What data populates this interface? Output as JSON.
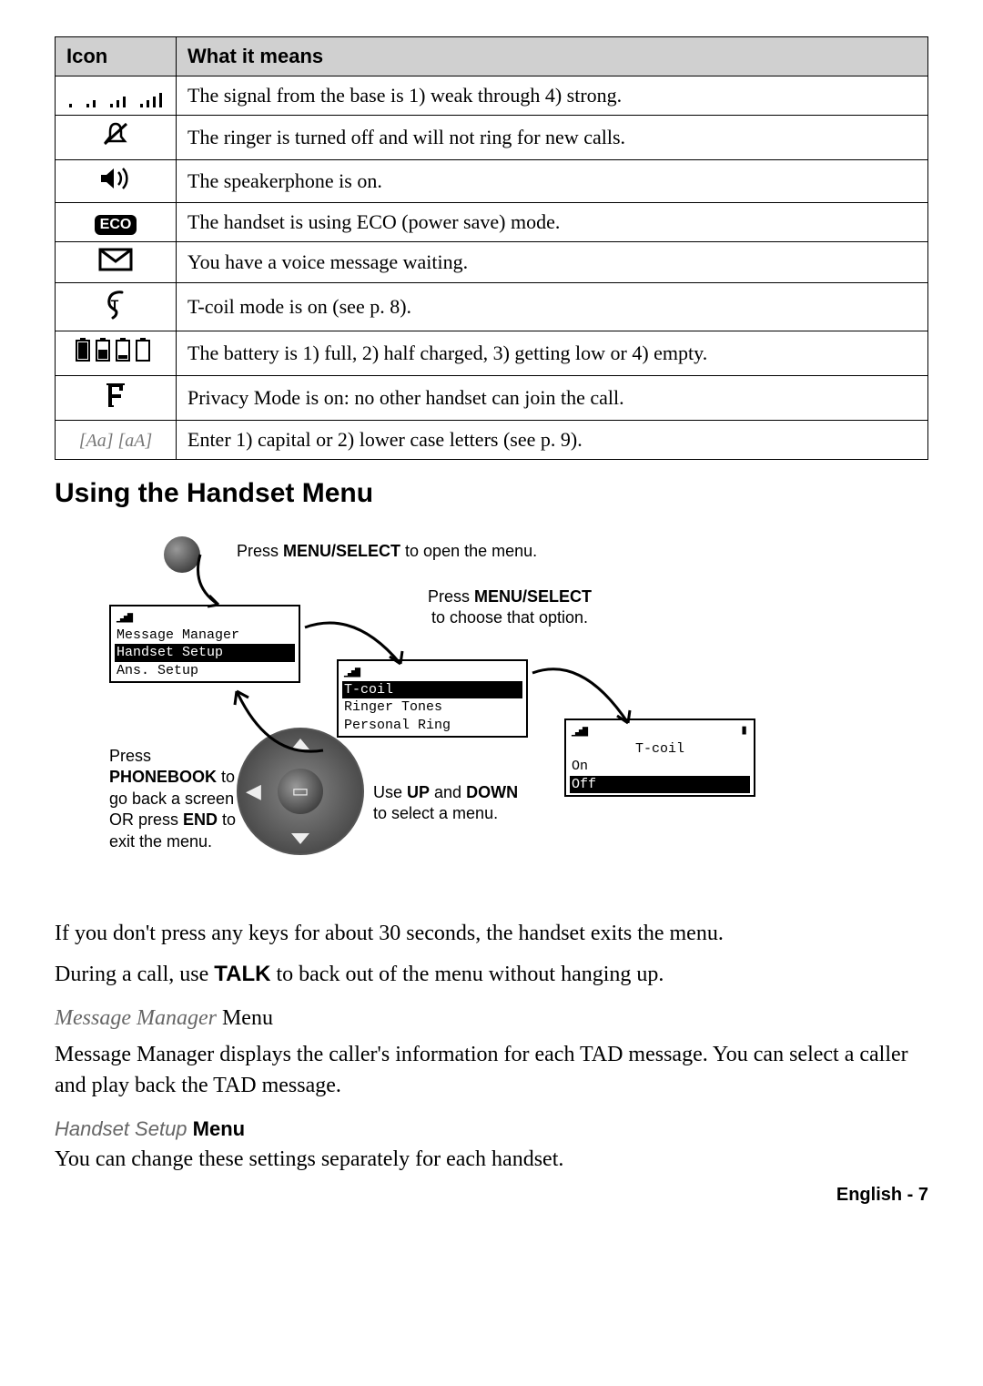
{
  "table": {
    "header_icon": "Icon",
    "header_meaning": "What it means",
    "rows": [
      {
        "icon_name": "signal-bars-icon",
        "meaning": "The signal from the base is 1) weak through 4) strong."
      },
      {
        "icon_name": "ringer-off-icon",
        "meaning": "The ringer is turned off and will not ring for new calls."
      },
      {
        "icon_name": "speakerphone-icon",
        "meaning": "The speakerphone is on."
      },
      {
        "icon_name": "eco-mode-icon",
        "icon_text": "ECO",
        "meaning": "The handset is using ECO (power save) mode."
      },
      {
        "icon_name": "voicemail-icon",
        "meaning": "You have a voice message waiting."
      },
      {
        "icon_name": "tcoil-icon",
        "meaning": "T-coil mode is on (see p. 8)."
      },
      {
        "icon_name": "battery-levels-icon",
        "meaning": "The battery is 1) full, 2) half charged, 3) getting low or 4) empty."
      },
      {
        "icon_name": "privacy-mode-icon",
        "meaning": "Privacy Mode is on: no other handset can join the call."
      },
      {
        "icon_name": "letter-case-icon",
        "icon_label": "[Aa] [aA]",
        "meaning": "Enter 1) capital or 2) lower case letters (see p. 9)."
      }
    ]
  },
  "section_heading": "Using the Handset Menu",
  "diagram": {
    "caption_open": {
      "pre": "Press ",
      "key": "MENU/SELECT",
      "post": " to open the menu."
    },
    "caption_choose": {
      "pre": "Press ",
      "key": "MENU/SELECT",
      "post": " to choose that option."
    },
    "caption_updown": {
      "pre": "Use ",
      "key1": "UP",
      "mid": " and ",
      "key2": "DOWN",
      "post": " to select a menu."
    },
    "caption_back": {
      "pre": "Press ",
      "key1": "PHONEBOOK",
      "mid": " to go back a screen OR press ",
      "key2": "END",
      "post": " to exit the menu."
    },
    "screen1": {
      "line1": "Message Manager",
      "line2_sel": "Handset Setup",
      "line3": "Ans. Setup"
    },
    "screen2": {
      "line1_sel": "T-coil",
      "line2": "Ringer Tones",
      "line3": "Personal Ring"
    },
    "screen3": {
      "title": "T-coil",
      "line1": "On",
      "line2_sel": "Off"
    }
  },
  "body": {
    "timeout": "If you don't press any keys for about 30 seconds, the handset exits the menu.",
    "during_call_pre": "During a call, use ",
    "during_call_key": "TALK",
    "during_call_post": " to back out of the menu without hanging up.",
    "msg_mgr_title_em": "Message Manager",
    "msg_mgr_title_rest": " Menu",
    "msg_mgr_body": "Message Manager displays the caller's information for each TAD message. You can select a caller and play back the TAD message.",
    "handset_title_em": "Handset Setup",
    "handset_title_bold": " Menu",
    "handset_body": "You can change these settings separately for each handset."
  },
  "footer": "English - 7"
}
